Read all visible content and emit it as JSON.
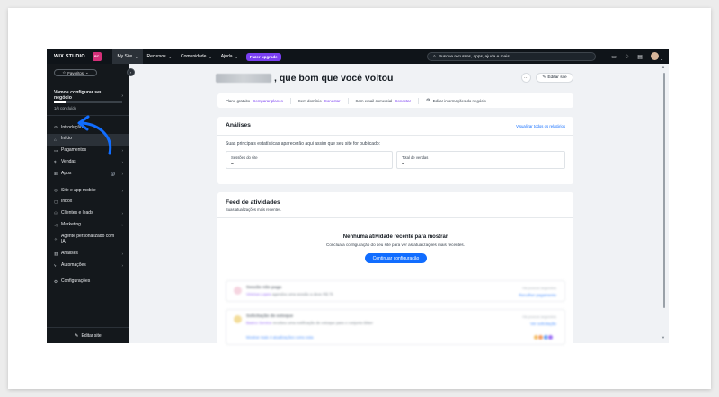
{
  "topbar": {
    "logo": "WIX STUDIO",
    "site_avatar": "RC",
    "nav": [
      {
        "label": "My Site"
      },
      {
        "label": "Recursos"
      },
      {
        "label": "Comunidade"
      },
      {
        "label": "Ajuda"
      }
    ],
    "upgrade_label": "Fazer upgrade",
    "search_placeholder": "Busque recursos, apps, ajuda e mais"
  },
  "sidebar": {
    "favorites_label": "Favoritos",
    "setup_title": "Vamos configurar seu negócio",
    "setup_count": "1/6 concluído",
    "setup_progress": 0.1667,
    "items": [
      {
        "label": "Introdução",
        "icon": "compass-icon"
      },
      {
        "label": "Início",
        "icon": "home-icon"
      },
      {
        "label": "Pagamentos",
        "icon": "card-icon"
      },
      {
        "label": "Vendas",
        "icon": "dollar-icon"
      },
      {
        "label": "Apps",
        "icon": "grid-icon"
      },
      {
        "label": "Site e app mobile",
        "icon": "globe-icon"
      },
      {
        "label": "Inbox",
        "icon": "inbox-icon"
      },
      {
        "label": "Clientes e leads",
        "icon": "people-icon"
      },
      {
        "label": "Marketing",
        "icon": "megaphone-icon"
      },
      {
        "label": "Agente personalizado com IA",
        "icon": "sparkle-icon"
      },
      {
        "label": "Análises",
        "icon": "chart-icon"
      },
      {
        "label": "Automações",
        "icon": "bolt-icon"
      },
      {
        "label": "Configurações",
        "icon": "gear-icon"
      }
    ],
    "edit_site_label": "Editar site"
  },
  "header": {
    "greeting": ", que bom que você voltou",
    "edit_site_label": "Editar site"
  },
  "plan_bar": {
    "plan_label": "Plano gratuito",
    "plan_link": "Comparar planos",
    "domain_label": "Sem domínio",
    "domain_link": "Conectar",
    "email_label": "Sem email comercial",
    "email_link": "Conectar",
    "business_info": "Editar informações do negócio"
  },
  "analytics": {
    "title": "Análises",
    "link": "Visualizar todos os relatórios",
    "subtitle": "Suas principais estatísticas aparecerão aqui assim que seu site for publicado:",
    "stats": [
      {
        "label": "Sessões do site",
        "value": "–"
      },
      {
        "label": "Total de vendas",
        "value": "–"
      }
    ]
  },
  "feed": {
    "title": "Feed de atividades",
    "subtitle": "Suas atualizações mais recentes.",
    "empty_title": "Nenhuma atividade recente para mostrar",
    "empty_subtitle": "Conclua a configuração do seu site para ver as atualizações mais recentes.",
    "cta_label": "Continuar configuração",
    "ghost_items": [
      {
        "title": "Sessão não paga",
        "name": "Vinicius Lopes",
        "text": "agendou uma sessão a deve R$ 75",
        "time": "Há poucos segundos",
        "action": "Recolher pagamento"
      },
      {
        "title": "Solicitação de estoque",
        "name": "Basico Service",
        "text": "recebeu uma notificação de estoque para o conjunto Bitter",
        "time": "Há poucos segundos",
        "action": "Ver solicitação",
        "more": "Mostrar mais 4 atualizações como esta"
      }
    ]
  },
  "colors": {
    "topbar_bg": "#0f1419",
    "sidebar_bg": "#14181c",
    "accent_blue": "#116dff",
    "accent_purple": "#7a3ff2",
    "arrow_blue": "#116dff"
  }
}
